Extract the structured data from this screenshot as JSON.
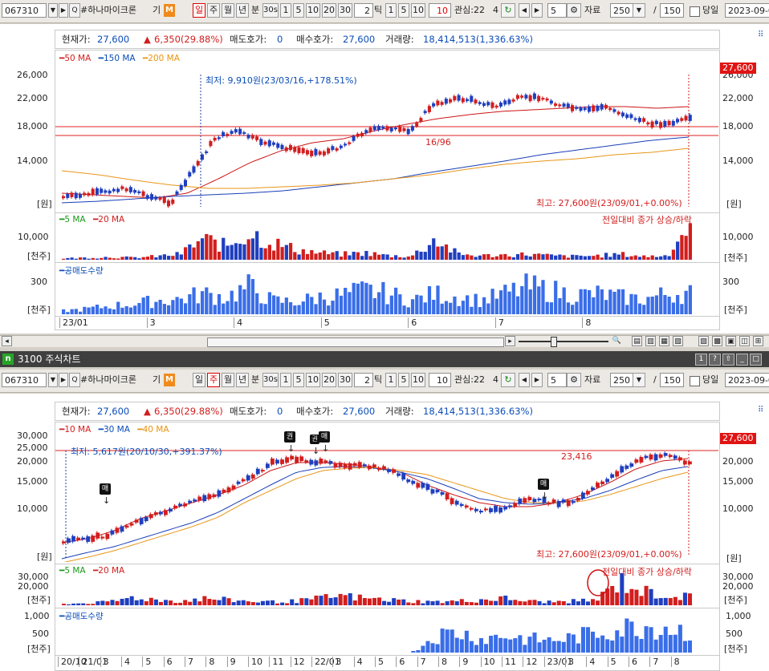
{
  "toolbar": {
    "code": "067310",
    "name": "#하나마이크론",
    "name_suffix": "기",
    "m_badge": "M",
    "period_day": "일",
    "period_week": "주",
    "period_month": "월",
    "period_year": "년",
    "minute": "분",
    "sec30": "30s",
    "n1": "1",
    "n5": "5",
    "n10": "10",
    "n20": "20",
    "n30": "30",
    "tick_count": "2",
    "tick_label": "틱",
    "t1": "1",
    "t5": "5",
    "t10": "10",
    "interest_label": "관심:22",
    "interest_sep": "4",
    "step": "5",
    "data_label": "자료",
    "data_count": "250",
    "slash": "/",
    "view_count": "150",
    "today_label": "당일",
    "date": "2023-09-0"
  },
  "chart1": {
    "info": {
      "price_label": "현재가:",
      "price": "27,600",
      "change": "6,350(29.88%)",
      "ask_label": "매도호가:",
      "ask": "0",
      "bid_label": "매수호가:",
      "bid": "27,600",
      "volume_label": "거래량:",
      "volume": "18,414,513(1,336.63%)"
    },
    "legend": [
      "50 MA",
      "150 MA",
      "200 MA"
    ],
    "y_ticks": [
      "26,000",
      "22,000",
      "18,000",
      "14,000"
    ],
    "unit": "[원]",
    "price_badge": "27,600",
    "low_annotation": "최저: 9,910원(23/03/16,+178.51%)",
    "high_annotation": "최고: 27,600원(23/09/01,+0.00%)",
    "ratio_annotation": "16/96",
    "vol_legend": [
      "5 MA",
      "20 MA"
    ],
    "vol_note": "전일대비 종가 상승/하락",
    "vol_tick": "10,000",
    "vol_unit": "[천주]",
    "short_legend": "공매도수량",
    "short_tick": "300",
    "short_unit": "[천주]",
    "x_labels": [
      "23/01",
      "3",
      "4",
      "5",
      "6",
      "7",
      "8"
    ]
  },
  "title2": {
    "icon": "n",
    "title": "3100 주식차트"
  },
  "chart2": {
    "info": {
      "price_label": "현재가:",
      "price": "27,600",
      "change": "6,350(29.88%)",
      "ask_label": "매도호가:",
      "ask": "0",
      "bid_label": "매수호가:",
      "bid": "27,600",
      "volume_label": "거래량:",
      "volume": "18,414,513(1,336.63%)"
    },
    "legend": [
      "10 MA",
      "30 MA",
      "40 MA"
    ],
    "y_ticks": [
      "30,000",
      "25,000",
      "20,000",
      "15,000",
      "10,000"
    ],
    "unit": "[원]",
    "price_badge": "27,600",
    "low_annotation": "최저: 5,617원(20/10/30,+391.37%)",
    "high_annotation": "최고: 27,600원(23/09/01,+0.00%)",
    "line_value": "23,416",
    "markers": [
      "매",
      "권",
      "권",
      "매",
      "매"
    ],
    "vol_legend": [
      "5 MA",
      "20 MA"
    ],
    "vol_note": "전일대비 종가 상승/하락",
    "vol_ticks": [
      "30,000",
      "20,000"
    ],
    "vol_unit": "[천주]",
    "short_legend": "공매도수량",
    "short_ticks": [
      "1,000",
      "500"
    ],
    "short_unit": "[천주]",
    "x_labels": [
      "20/10",
      "21/01",
      "3",
      "4",
      "5",
      "6",
      "7",
      "8",
      "9",
      "10",
      "11",
      "12",
      "22/01",
      "3",
      "4",
      "5",
      "6",
      "7",
      "8",
      "9",
      "10",
      "11",
      "12",
      "23/01",
      "3",
      "4",
      "5",
      "6",
      "7",
      "8"
    ]
  },
  "colors": {
    "up": "#d21e1e",
    "down": "#1f3fbf",
    "ma_short": "#cc1515",
    "ma_mid": "#1a3fb8",
    "ma_long": "#e8961a",
    "vol_ma5": "#1a9a1a",
    "short_bar": "#3a6ee8"
  }
}
